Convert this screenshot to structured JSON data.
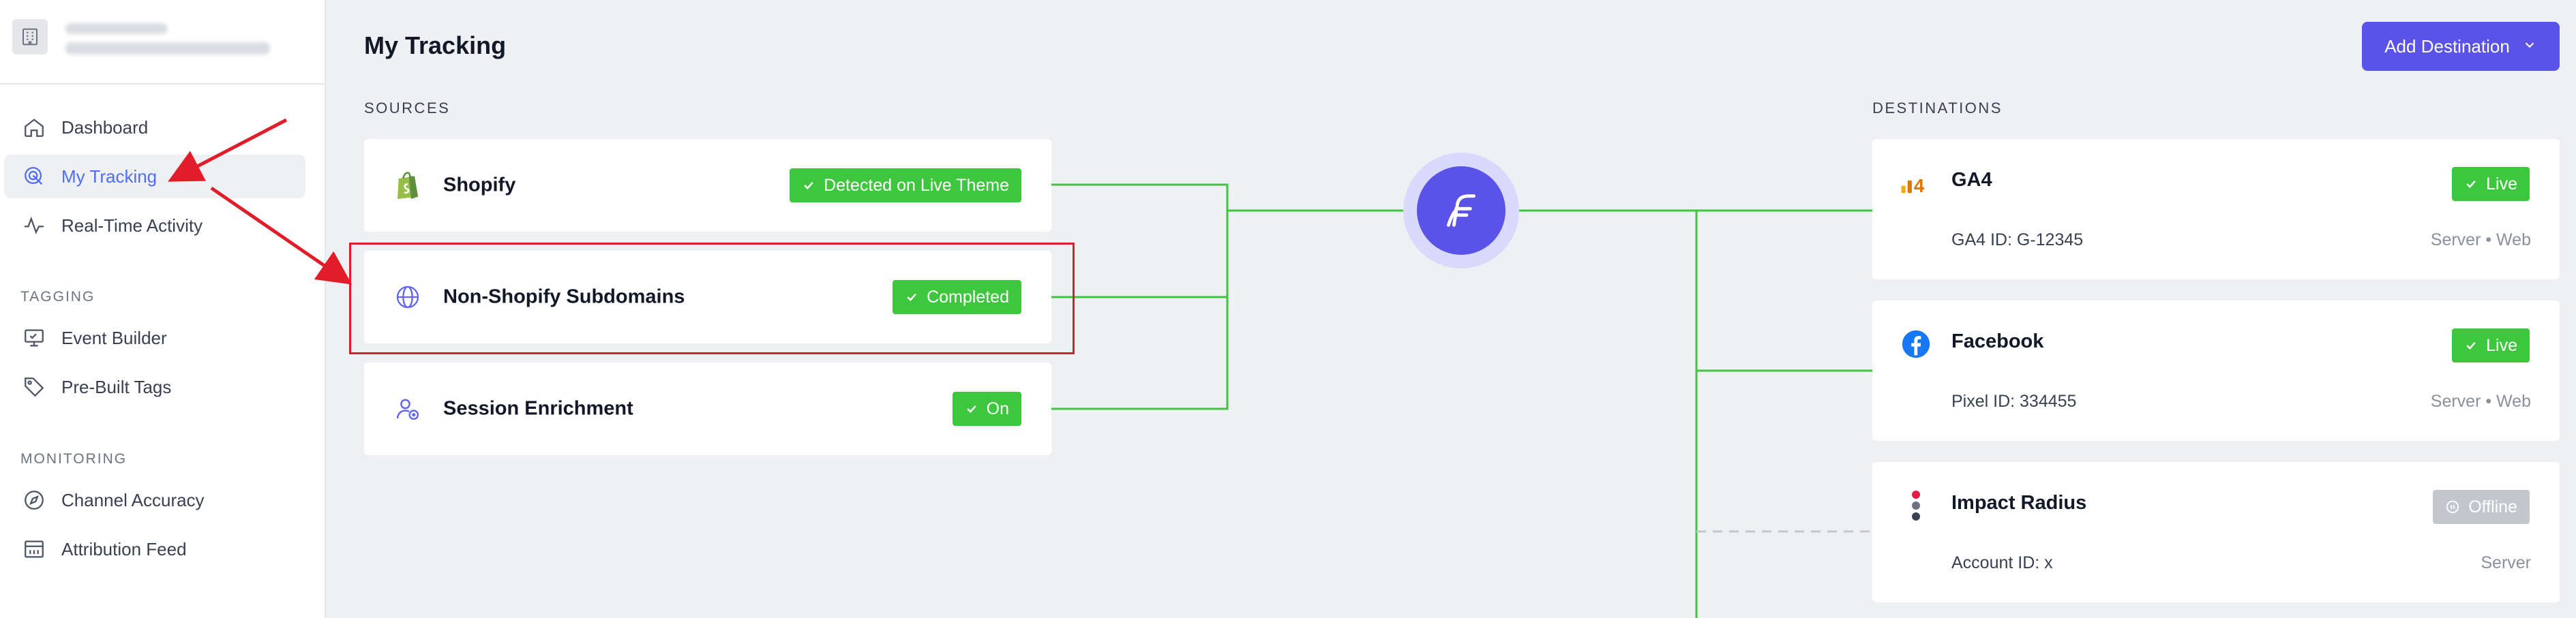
{
  "sidebar": {
    "items": [
      {
        "label": "Dashboard",
        "icon": "home-icon"
      },
      {
        "label": "My Tracking",
        "icon": "target-icon",
        "active": true
      },
      {
        "label": "Real-Time Activity",
        "icon": "activity-icon"
      }
    ],
    "sections": [
      {
        "label": "TAGGING",
        "items": [
          {
            "label": "Event Builder",
            "icon": "monitor-icon"
          },
          {
            "label": "Pre-Built Tags",
            "icon": "tag-icon"
          }
        ]
      },
      {
        "label": "MONITORING",
        "items": [
          {
            "label": "Channel Accuracy",
            "icon": "compass-icon"
          },
          {
            "label": "Attribution Feed",
            "icon": "table-icon"
          }
        ]
      }
    ]
  },
  "header": {
    "title": "My Tracking",
    "add_destination": "Add Destination"
  },
  "sources": {
    "label": "SOURCES",
    "items": [
      {
        "name": "Shopify",
        "status": "Detected on Live Theme",
        "icon": "shopify-bag-icon"
      },
      {
        "name": "Non-Shopify Subdomains",
        "status": "Completed",
        "icon": "globe-icon"
      },
      {
        "name": "Session Enrichment",
        "status": "On",
        "icon": "user-settings-icon"
      }
    ]
  },
  "destinations": {
    "label": "DESTINATIONS",
    "items": [
      {
        "name": "GA4",
        "id_text": "GA4 ID: G-12345",
        "meta": "Server • Web",
        "status": "Live",
        "icon": "ga4-icon"
      },
      {
        "name": "Facebook",
        "id_text": "Pixel ID: 334455",
        "meta": "Server • Web",
        "status": "Live",
        "icon": "facebook-icon"
      },
      {
        "name": "Impact Radius",
        "id_text": "Account ID: x",
        "meta": "Server",
        "status": "Offline",
        "icon": "impact-icon"
      }
    ]
  },
  "colors": {
    "accent": "#5b53e8",
    "success": "#3fc63f",
    "connector": "#3fc63f",
    "annotation": "#e11d2a",
    "offline": "#c3c7cd"
  }
}
